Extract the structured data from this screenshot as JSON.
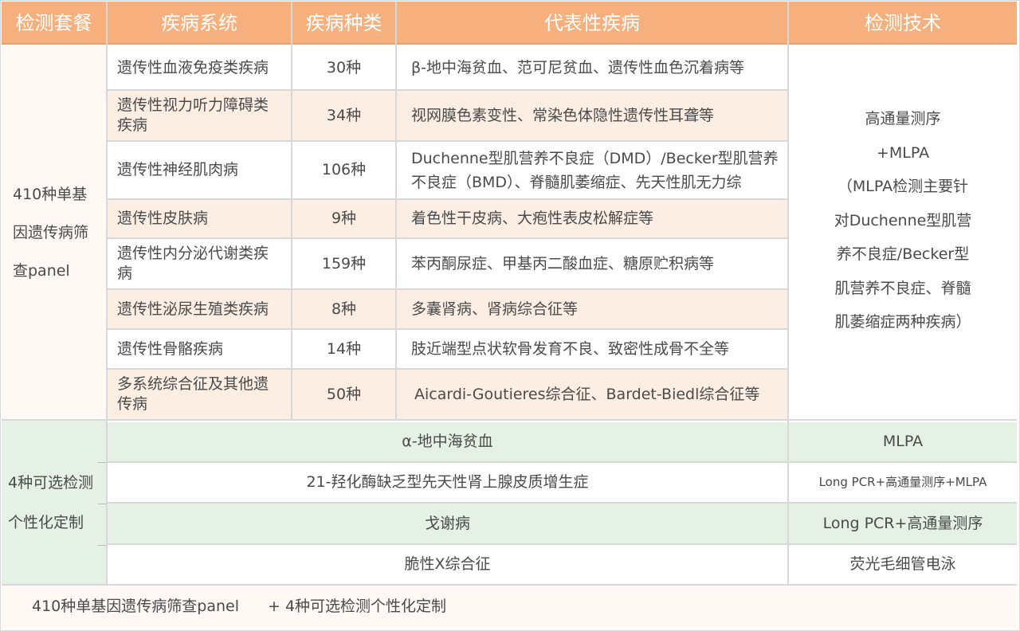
{
  "headers": [
    "检测套餐",
    "疾病系统",
    "疾病种类",
    "代表性疾病",
    "检测技术"
  ],
  "panel1": {
    "lines": [
      "410种单基",
      "因遗传病筛",
      "查panel"
    ],
    "rows": [
      {
        "system": "遗传性血液免疫类疾病",
        "count": "30种",
        "diseases": "β-地中海贫血、范可尼贫血、遗传性血色沉着病等"
      },
      {
        "system": "遗传性视力听力障碍类疾病",
        "count": "34种",
        "diseases": "视网膜色素变性、常染色体隐性遗传性耳聋等"
      },
      {
        "system": "遗传性神经肌肉病",
        "count": "106种",
        "diseases": "Duchenne型肌营养不良症（DMD）/Becker型肌营养不良症（BMD）、脊髓肌萎缩症、先天性肌无力综"
      },
      {
        "system": "遗传性皮肤病",
        "count": "9种",
        "diseases": "着色性干皮病、大疱性表皮松解症等"
      },
      {
        "system": "遗传性内分泌代谢类疾病",
        "count": "159种",
        "diseases": "苯丙酮尿症、甲基丙二酸血症、糖原贮积病等"
      },
      {
        "system": "遗传性泌尿生殖类疾病",
        "count": "8种",
        "diseases": "多囊肾病、肾病综合征等"
      },
      {
        "system": "遗传性骨骼疾病",
        "count": "14种",
        "diseases": "肢近端型点状软骨发育不良、致密性成骨不全等"
      },
      {
        "system": "多系统综合征及其他遗传病",
        "count": "50种",
        "diseases": "Aicardi-Goutieres综合征、Bardet-Biedl综合征等"
      }
    ],
    "tech_lines": [
      "高通量测序",
      "+MLPA",
      "（MLPA检测主要针",
      "对Duchenne型肌营",
      "养不良症/Becker型",
      "肌营养不良症、脊髓",
      "肌萎缩症两种疾病）"
    ]
  },
  "panel2": {
    "lines": [
      "4种可选检测",
      "个性化定制"
    ],
    "rows": [
      {
        "disease": "α-地中海贫血",
        "tech": "MLPA"
      },
      {
        "disease": "21-羟化酶缺乏型先天性肾上腺皮质增生症",
        "tech": "Long PCR+高通量测序+MLPA"
      },
      {
        "disease": "戈谢病",
        "tech": "Long PCR+高通量测序"
      },
      {
        "disease": "脆性X综合征",
        "tech": "荧光毛细管电泳"
      }
    ]
  },
  "footer": {
    "left": "410种单基因遗传病筛查panel",
    "right": "+ 4种可选检测个性化定制"
  }
}
